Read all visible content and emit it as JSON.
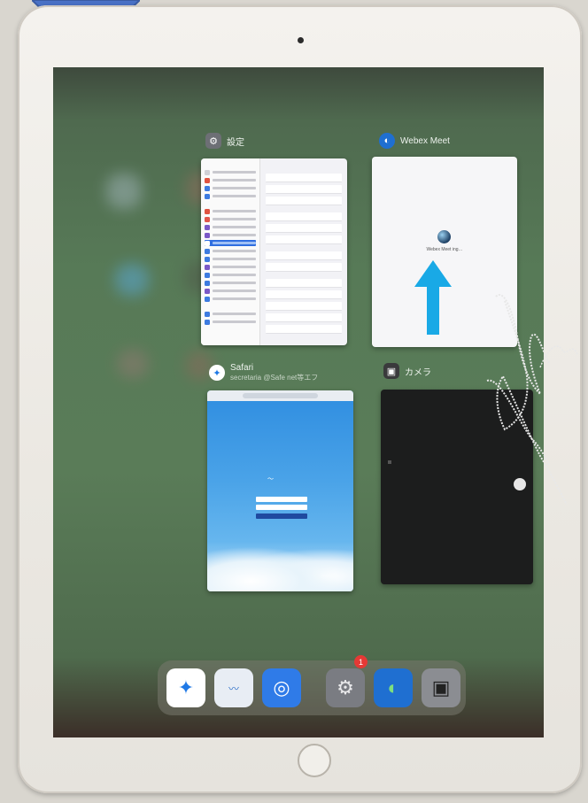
{
  "cards": {
    "settings": {
      "title": "設定",
      "icon": "gear-icon"
    },
    "webex": {
      "title": "Webex Meet",
      "loading_text": "Webex Meet ing…",
      "icon": "webex-icon"
    },
    "safari": {
      "title": "Safari",
      "subtitle": "secretaria @Safe net等エフ",
      "icon": "compass-icon"
    },
    "camera": {
      "title": "カメラ",
      "icon": "camera-icon"
    }
  },
  "dock": {
    "apps": [
      {
        "name": "Safari",
        "icon": "compass-icon"
      },
      {
        "name": "Forms app",
        "icon": "app-icon"
      },
      {
        "name": "Support",
        "icon": "lifebuoy-icon"
      },
      {
        "name": "Settings",
        "icon": "gear-icon",
        "badge": "1"
      },
      {
        "name": "Webex",
        "icon": "webex-icon"
      },
      {
        "name": "Camera",
        "icon": "camera-icon"
      }
    ]
  },
  "colors": {
    "annotation_arrow": "#4a72c7",
    "swipe_arrow": "#19a9e6"
  }
}
